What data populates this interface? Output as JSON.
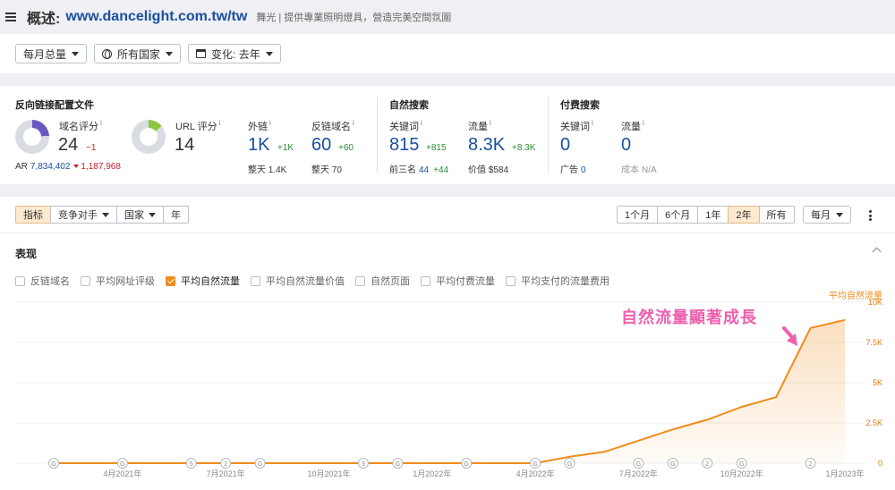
{
  "header": {
    "title": "概述:",
    "url": "www.dancelight.com.tw/tw",
    "description": "舞光 | 提供專業照明燈具，營造完美空間氛圍"
  },
  "filters": {
    "mode": "每月总量",
    "country": "所有国家",
    "change": "变化: 去年"
  },
  "backlinks": {
    "section_title": "反向链接配置文件",
    "dr_label": "域名评分",
    "dr_value": "24",
    "dr_delta": "−1",
    "ar_label": "AR",
    "ar_value": "7,834,402",
    "ar_delta": "1,187,968",
    "ur_label": "URL 评分",
    "ur_value": "14",
    "backlinks_label": "外链",
    "backlinks_value": "1K",
    "backlinks_delta": "+1K",
    "backlinks_sub_label": "整天",
    "backlinks_sub_value": "1.4K",
    "refdomains_label": "反链域名",
    "refdomains_value": "60",
    "refdomains_delta": "+60",
    "refdomains_sub_label": "整天",
    "refdomains_sub_value": "70"
  },
  "organic": {
    "section_title": "自然搜索",
    "keywords_label": "关键词",
    "keywords_value": "815",
    "keywords_delta": "+815",
    "top3_label": "前三名",
    "top3_value": "44",
    "top3_delta": "+44",
    "traffic_label": "流量",
    "traffic_value": "8.3K",
    "traffic_delta": "+8.3K",
    "value_label": "价值",
    "value_value": "$584"
  },
  "paid": {
    "section_title": "付费搜索",
    "keywords_label": "关键词",
    "keywords_value": "0",
    "ads_label": "广告",
    "ads_value": "0",
    "traffic_label": "流量",
    "traffic_value": "0",
    "cost_label": "成本",
    "cost_value": "N/A"
  },
  "chart_toolbar": {
    "tabs": [
      "指标",
      "竞争对手",
      "国家",
      "年"
    ],
    "ranges": [
      "1个月",
      "6个月",
      "1年",
      "2年",
      "所有"
    ],
    "active_range": "2年",
    "granularity": "每月"
  },
  "performance": {
    "title": "表现",
    "checkboxes": [
      {
        "label": "反链域名",
        "checked": false
      },
      {
        "label": "平均网址评级",
        "checked": false
      },
      {
        "label": "平均自然流量",
        "checked": true
      },
      {
        "label": "平均自然流量价值",
        "checked": false
      },
      {
        "label": "自然页面",
        "checked": false
      },
      {
        "label": "平均付费流量",
        "checked": false
      },
      {
        "label": "平均支付的流量费用",
        "checked": false
      }
    ],
    "annotation": "自然流量顯著成長"
  },
  "colors": {
    "accent": "#f08c1a",
    "link_blue": "#1a4fa0",
    "positive": "#2e8b3a",
    "negative": "#c8202f",
    "annotation_pink": "#ee5fae",
    "dr_donut": "#6b57c2",
    "ur_donut": "#8dc63f"
  },
  "chart_data": {
    "type": "area",
    "series": [
      {
        "name": "平均自然流量",
        "color": "#f08c1a",
        "x": [
          "2021-02",
          "2021-03",
          "2021-04",
          "2021-05",
          "2021-06",
          "2021-07",
          "2021-08",
          "2021-09",
          "2021-10",
          "2021-11",
          "2021-12",
          "2022-01",
          "2022-02",
          "2022-03",
          "2022-04",
          "2022-05",
          "2022-06",
          "2022-07",
          "2022-08",
          "2022-09",
          "2022-10",
          "2022-11",
          "2022-12",
          "2023-01"
        ],
        "values": [
          0,
          0,
          0,
          0,
          0,
          0,
          0,
          0,
          0,
          0,
          0,
          0,
          0,
          0,
          0,
          400,
          700,
          1400,
          2100,
          2700,
          3500,
          4100,
          8400,
          8900
        ]
      }
    ],
    "x_tick_labels": [
      "4月2021年",
      "7月2021年",
      "10月2021年",
      "1月2022年",
      "4月2022年",
      "7月2022年",
      "10月2022年",
      "1月2023年"
    ],
    "y_tick_labels": [
      "10K",
      "7.5K",
      "5K",
      "2.5K",
      "0"
    ],
    "ylabel": "平均自然流量",
    "ylim": [
      0,
      11000
    ],
    "grid": true,
    "event_markers": [
      {
        "x": "2021-02",
        "label": "G"
      },
      {
        "x": "2021-04",
        "label": "G"
      },
      {
        "x": "2021-06",
        "label": "5"
      },
      {
        "x": "2021-07",
        "label": "2"
      },
      {
        "x": "2021-08",
        "label": "G"
      },
      {
        "x": "2021-11",
        "label": "3"
      },
      {
        "x": "2021-12",
        "label": "G"
      },
      {
        "x": "2022-02",
        "label": "G"
      },
      {
        "x": "2022-04",
        "label": "G"
      },
      {
        "x": "2022-05",
        "label": "G"
      },
      {
        "x": "2022-07",
        "label": "G"
      },
      {
        "x": "2022-08",
        "label": "G"
      },
      {
        "x": "2022-09",
        "label": "2"
      },
      {
        "x": "2022-10",
        "label": "G"
      },
      {
        "x": "2022-12",
        "label": "2"
      }
    ]
  }
}
